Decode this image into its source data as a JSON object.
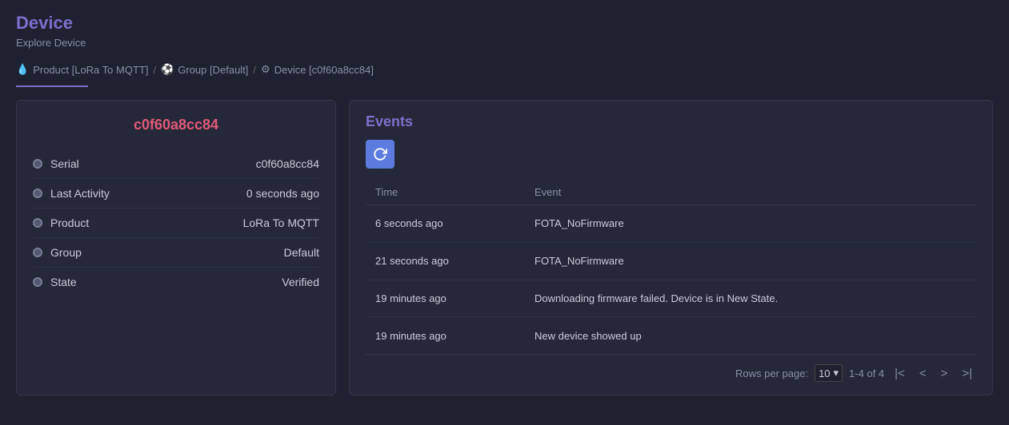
{
  "header": {
    "title": "Device",
    "subtitle": "Explore Device"
  },
  "breadcrumb": {
    "product_icon": "💧",
    "product_label": "Product [LoRa To MQTT]",
    "separator1": "/",
    "group_icon": "⚽",
    "group_label": "Group [Default]",
    "separator2": "/",
    "device_icon": "⚙",
    "device_label": "Device [c0f60a8cc84]"
  },
  "device_panel": {
    "device_id": "c0f60a8cc84",
    "fields": [
      {
        "label": "Serial",
        "value": "c0f60a8cc84"
      },
      {
        "label": "Last Activity",
        "value": "0 seconds ago"
      },
      {
        "label": "Product",
        "value": "LoRa To MQTT"
      },
      {
        "label": "Group",
        "value": "Default"
      },
      {
        "label": "State",
        "value": "Verified"
      }
    ]
  },
  "events_panel": {
    "title": "Events",
    "refresh_label": "↻",
    "table": {
      "headers": [
        "Time",
        "Event"
      ],
      "rows": [
        {
          "time": "6 seconds ago",
          "event": "FOTA_NoFirmware"
        },
        {
          "time": "21 seconds ago",
          "event": "FOTA_NoFirmware"
        },
        {
          "time": "19 minutes ago",
          "event": "Downloading firmware failed. Device is in New State."
        },
        {
          "time": "19 minutes ago",
          "event": "New device showed up"
        }
      ]
    },
    "pagination": {
      "rows_per_page_label": "Rows per page:",
      "rows_per_page_value": "10",
      "range_label": "1-4 of 4",
      "first_btn": "|<",
      "prev_btn": "<",
      "next_btn": ">",
      "last_btn": ">|"
    }
  }
}
